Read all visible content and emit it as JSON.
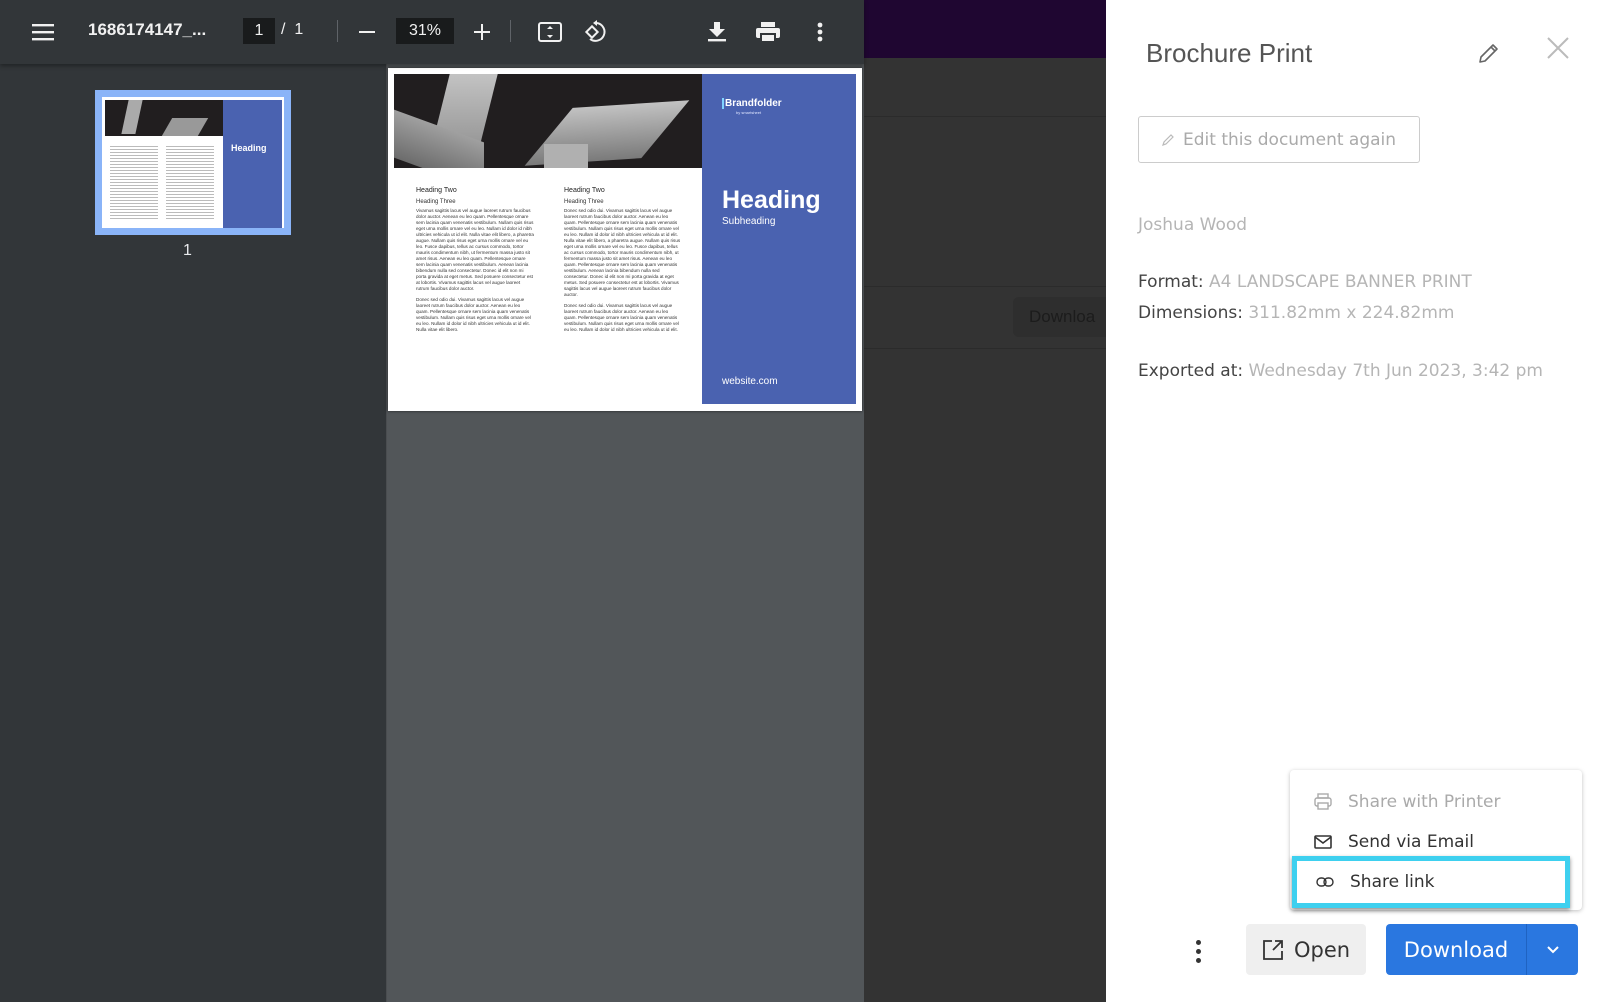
{
  "pdf_viewer": {
    "filename": "1686174147_...",
    "current_page": "1",
    "page_separator": "/",
    "total_pages": "1",
    "zoom_level": "31%",
    "thumbnail_label": "1",
    "icons": [
      "menu-icon",
      "zoom-out-icon",
      "zoom-in-icon",
      "fit-page-icon",
      "rotate-icon",
      "download-icon",
      "print-icon",
      "more-vert-icon"
    ]
  },
  "document": {
    "logo_text": "Brandfolder",
    "logo_subtext": "by smartsheet",
    "heading": "Heading",
    "subheading": "Subheading",
    "website": "website.com",
    "columns": [
      {
        "heading_two": "Heading Two",
        "heading_three": "Heading Three",
        "paragraphs": [
          "Vivamus sagittis lacus vel augue laoreet rutrum faucibus dolor auctor. Aenean eu leo quam. Pellentesque ornare sem lacinia quam venenatis vestibulum. Nullam quis risus eget urna mollis ornare vel eu leo. Nullam id dolor id nibh ultricies vehicula ut id elit. Nulla vitae elit libero, a pharetra augue. Nullam quis risus eget urna mollis ornare vel eu leo. Fusce dapibus, tellus ac cursus commodo, tortor mauris condimentum nibh, ut fermentum massa justo sit amet risus. Aenean eu leo quam. Pellentesque ornare sem lacinia quam venenatis vestibulum. Aenean lacinia bibendum nulla sed consectetur. Donec id elit non mi porta gravida at eget metus. Sed posuere consectetur est at lobortis. Vivamus sagittis lacus vel augue laoreet rutrum faucibus dolor auctor.",
          "Donec sed odio dui. Vivamus sagittis lacus vel augue laoreet rutrum faucibus dolor auctor. Aenean eu leo quam. Pellentesque ornare sem lacinia quam venenatis vestibulum. Nullam quis risus eget urna mollis ornare vel eu leo. Nullam id dolor id nibh ultricies vehicula ut id elit. Nulla vitae elit libero."
        ]
      },
      {
        "heading_two": "Heading Two",
        "heading_three": "Heading Three",
        "paragraphs": [
          "Donec sed odio dui. Vivamus sagittis lacus vel augue laoreet rutrum faucibus dolor auctor. Aenean eu leo quam. Pellentesque ornare sem lacinia quam venenatis vestibulum. Nullam quis risus eget urna mollis ornare vel eu leo. Nullam id dolor id nibh ultricies vehicula ut id elit. Nulla vitae elit libero, a pharetra augue. Nullam quis risus eget urna mollis ornare vel eu leo. Fusce dapibus, tellus ac cursus commodo, tortor mauris condimentum nibh, ut fermentum massa justo sit amet risus. Aenean eu leo quam. Pellentesque ornare sem lacinia quam venenatis vestibulum. Aenean lacinia bibendum nulla sed consectetur. Donec id elit non mi porta gravida at eget metus. Sed posuere consectetur est at lobortis. Vivamus sagittis lacus vel augue laoreet rutrum faucibus dolor auctor.",
          "Donec sed odio dui. Vivamus sagittis lacus vel augue laoreet rutrum faucibus dolor auctor. Aenean eu leo quam. Pellentesque ornare sem lacinia quam venenatis vestibulum. Nullam quis risus eget urna mollis ornare vel eu leo. Nullam id dolor id nibh ultricies vehicula ut id elit."
        ]
      }
    ],
    "accent_color": "#4a62b0"
  },
  "background_page": {
    "download_label": "Downloa"
  },
  "panel": {
    "title": "Brochure Print",
    "edit_again_label": "Edit this document again",
    "author": "Joshua Wood",
    "format_label": "Format:",
    "format_value": "A4 LANDSCAPE BANNER PRINT",
    "dimensions_label": "Dimensions:",
    "dimensions_value": "311.82mm x 224.82mm",
    "exported_label": "Exported at:",
    "exported_value": "Wednesday 7th Jun 2023, 3:42 pm",
    "share_menu": [
      {
        "label": "Share with Printer",
        "icon": "printer-icon",
        "disabled": true
      },
      {
        "label": "Send via Email",
        "icon": "mail-icon",
        "disabled": false
      },
      {
        "label": "Share link",
        "icon": "link-icon",
        "disabled": false,
        "highlighted": true
      }
    ],
    "open_label": "Open",
    "download_label": "Download",
    "primary_color": "#2a77e0",
    "highlight_color": "#3ed0ef"
  }
}
